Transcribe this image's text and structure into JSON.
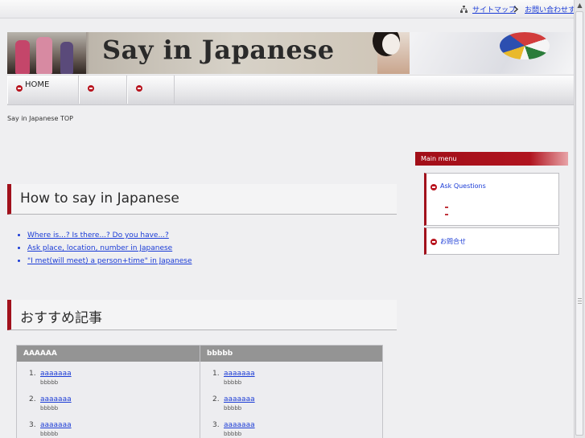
{
  "top_links": {
    "sitemap": "サイトマップ",
    "contact": "お問い合わせする"
  },
  "banner": {
    "title": "Say in Japanese"
  },
  "nav": {
    "home": "HOME",
    "tab2": "",
    "tab3": ""
  },
  "breadcrumb": "Say in Japanese TOP",
  "section1": {
    "heading": "How to say in Japanese",
    "links": [
      "Where is...? Is there...? Do you have...?",
      "Ask place, location, number in Japanese",
      "\"I met(will meet) a person+time\" in Japanese"
    ]
  },
  "section2": {
    "heading": "おすすめ記事"
  },
  "table": {
    "columns": [
      {
        "header": "AAAAAA",
        "items": [
          {
            "num": "1.",
            "main": "aaaaaaa",
            "sub": "bbbbb"
          },
          {
            "num": "2.",
            "main": "aaaaaaa",
            "sub": "bbbbb"
          },
          {
            "num": "3.",
            "main": "aaaaaaa",
            "sub": "bbbbb"
          }
        ]
      },
      {
        "header": "bbbbb",
        "items": [
          {
            "num": "1.",
            "main": "aaaaaaa",
            "sub": "bbbbb"
          },
          {
            "num": "2.",
            "main": "aaaaaaa",
            "sub": "bbbbb"
          },
          {
            "num": "3.",
            "main": "aaaaaaa",
            "sub": "bbbbb"
          }
        ]
      }
    ]
  },
  "sidebar": {
    "menu_title": "Main menu",
    "ask_questions": "Ask Questions",
    "second_link": "お問合せ"
  },
  "colors": {
    "accent": "#a1111c",
    "link": "#1a3bd6",
    "table_header": "#949494"
  }
}
